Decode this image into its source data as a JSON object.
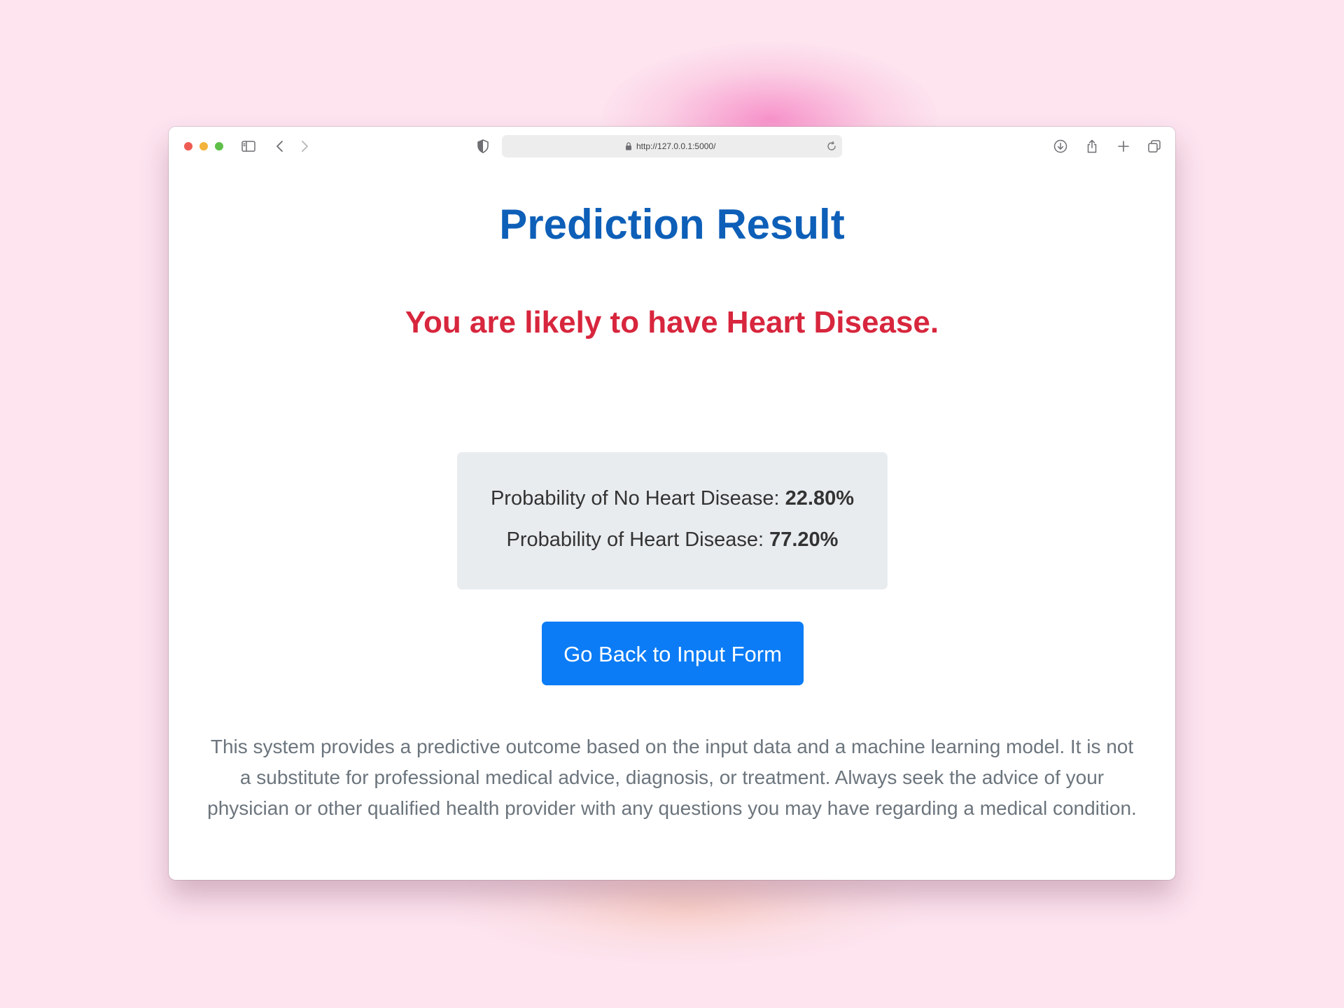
{
  "browser": {
    "url": "http://127.0.0.1:5000/"
  },
  "page": {
    "title": "Prediction Result",
    "verdict": "You are likely to have Heart Disease.",
    "probabilities": [
      {
        "label": "Probability of No Heart Disease: ",
        "value": "22.80%"
      },
      {
        "label": "Probability of Heart Disease: ",
        "value": "77.20%"
      }
    ],
    "back_button_label": "Go Back to Input Form",
    "disclaimer": "This system provides a predictive outcome based on the input data and a machine learning model. It is not a substitute for professional medical advice, diagnosis, or treatment. Always seek the advice of your physician or other qualified health provider with any questions you may have regarding a medical condition."
  },
  "colors": {
    "title": "#0d5fb8",
    "verdict": "#d7263d",
    "button": "#0b7cf6",
    "prob_box": "#e9ecef",
    "background": "#fde4ef"
  },
  "icons": [
    "sidebar-icon",
    "back-icon",
    "forward-icon",
    "shield-icon",
    "lock-icon",
    "reload-icon",
    "download-icon",
    "share-icon",
    "new-tab-icon",
    "tabs-overview-icon"
  ]
}
